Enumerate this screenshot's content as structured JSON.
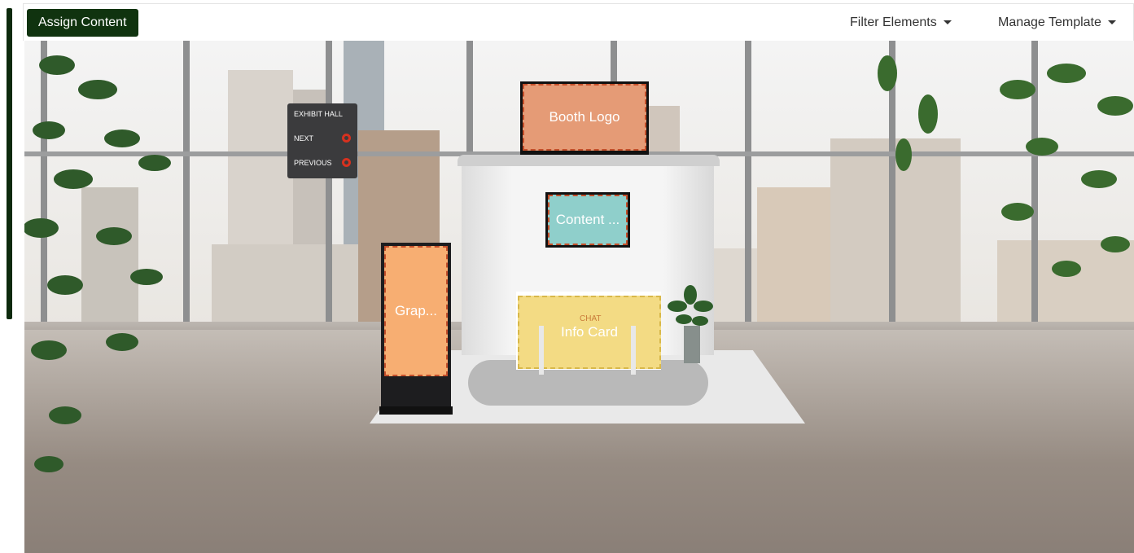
{
  "toolbar": {
    "assign_content_label": "Assign Content",
    "filter_elements_label": "Filter Elements",
    "manage_template_label": "Manage Template"
  },
  "sign": {
    "exhibit_hall": "EXHIBIT HALL",
    "next": "NEXT",
    "previous": "PREVIOUS"
  },
  "booth": {
    "logo_label": "Booth Logo",
    "content_label": "Content ...",
    "graphic_label": "Grap...",
    "info_card_label": "Info Card",
    "counter_badge": "CHAT"
  },
  "colors": {
    "accent_dark_green": "#10330f",
    "logo_fill": "#e59b76",
    "content_fill": "#8fcfcb",
    "graphic_fill": "#f7ae72",
    "info_fill": "#f3db84",
    "slot_border": "#c44f2a"
  }
}
